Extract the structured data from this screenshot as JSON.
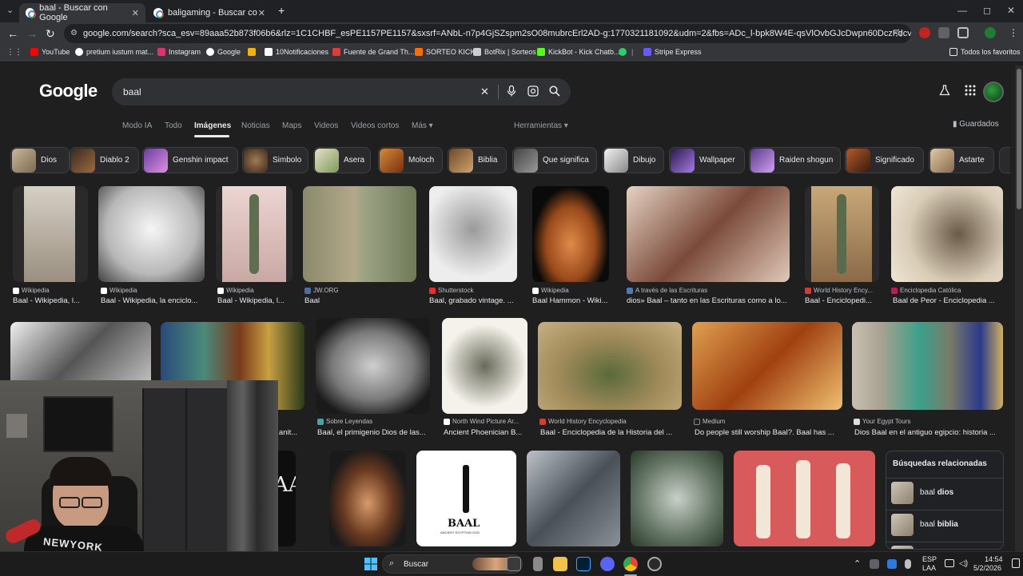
{
  "browser": {
    "tabs": [
      {
        "title": "baal - Buscar con Google",
        "close": "✕",
        "active": true
      },
      {
        "title": "baligaming - Buscar con Google",
        "close": "✕",
        "active": false
      }
    ],
    "new_tab": "+",
    "menu_chevron": "⌄",
    "window_controls": {
      "minimize": "—",
      "maximize": "◻",
      "close": "✕"
    },
    "nav": {
      "back": "←",
      "forward": "→",
      "reload": "↻"
    },
    "url": "google.com/search?sca_esv=89aaa52b873f06b6&rlz=1C1CHBF_esPE1157PE1157&sxsrf=ANbL-n7p4GjSZspm2sO08mubrcErl2AD-g:1770321181092&udm=2&fbs=ADc_l-bpk8W4E-qsVlOvbGJcDwpn60DczFdcvPnuv8WQohHLTbSVIdBrj9mdwFjf...",
    "star": "☆",
    "bookmarks": [
      {
        "label": "YouTube",
        "color": "#ff0000"
      },
      {
        "label": "pretium iustum mat...",
        "color": "#ffffff"
      },
      {
        "label": "Instagram",
        "color": "#e1306c"
      },
      {
        "label": "Google",
        "color": "#ffffff"
      },
      {
        "label": "",
        "color": "#f4b400"
      },
      {
        "label": "10Notificaciones",
        "color": "#ffffff"
      },
      {
        "label": "Fuente de Grand Th...",
        "color": "#e53935"
      },
      {
        "label": "SORTEO KICK",
        "color": "#ff6d00"
      },
      {
        "label": "BotRix | Sorteos",
        "color": "#cccccc"
      },
      {
        "label": "KickBot - Kick Chatb...",
        "color": "#53fc18"
      },
      {
        "label": "",
        "color": "#25d366"
      },
      {
        "label": "|",
        "color": "transparent"
      },
      {
        "label": "Stripe Express",
        "color": "#635bff"
      }
    ],
    "all_bookmarks": "Todos los favoritos"
  },
  "google": {
    "logo": "Google",
    "query": "baal",
    "icons": {
      "clear": "✕",
      "mic": "🎙",
      "lens": "◎",
      "search": "⌕",
      "labs": "⚗",
      "apps": "⋮⋮"
    },
    "tabs": [
      "Modo IA",
      "Todo",
      "Imágenes",
      "Noticias",
      "Maps",
      "Videos",
      "Videos cortos",
      "Más ▾"
    ],
    "tools": "Herramientas ▾",
    "saved": "Guardados",
    "chips": [
      "Dios",
      "Diablo 2",
      "Genshin impact",
      "Simbolo",
      "Asera",
      "Moloch",
      "Biblia",
      "Que significa",
      "Dibujo",
      "Wallpaper",
      "Raiden shogun",
      "Significado",
      "Astarte"
    ],
    "row1": [
      {
        "source": "Wikipedia",
        "title": "Baal - Wikipedia, l..."
      },
      {
        "source": "Wikipedia",
        "title": "Baal - Wikipedia, la enciclo..."
      },
      {
        "source": "Wikipedia",
        "title": "Baal - Wikipedia, l..."
      },
      {
        "source": "JW.ORG",
        "title": "Baal"
      },
      {
        "source": "Shutterstock",
        "title": "Baal, grabado vintage. ..."
      },
      {
        "source": "Wikipedia",
        "title": "Baal Hammon - Wiki..."
      },
      {
        "source": "A través de las Escrituras",
        "title": "dios» Baal – tanto en las Escrituras como a lo..."
      },
      {
        "source": "World History Ency...",
        "title": "Baal - Enciclopedi..."
      },
      {
        "source": "Enciclopedia Católica",
        "title": "Baal de Peor - Enciclopedia ..."
      }
    ],
    "row2": [
      {
        "source": "",
        "title": ""
      },
      {
        "source": "",
        "title": "...anit..."
      },
      {
        "source": "Sobre Leyendas",
        "title": "Baal, el primigenio Dios de las..."
      },
      {
        "source": "North Wind Picture Ar...",
        "title": "Ancient Phoenician B..."
      },
      {
        "source": "World History Encyclopedia",
        "title": "Baal - Enciclopedia de la Historia del ..."
      },
      {
        "source": "Medium",
        "title": "Do people still worship Baal?. Baal has ..."
      },
      {
        "source": "Your Egypt Tours",
        "title": "Dios Baal en el antiguo egipcio: historia ..."
      }
    ],
    "row3_text": {
      "baal_logo": "BAAL",
      "baal_logo_sub": "ANCIENT EGYPTIAN GOD",
      "partial_baal": "AAL"
    },
    "related": {
      "heading": "Búsquedas relacionadas",
      "items": [
        {
          "prefix": "baal ",
          "bold": "dios"
        },
        {
          "prefix": "baal ",
          "bold": "biblia"
        }
      ]
    }
  },
  "webcam": {
    "hoodie_text": "NEWYORK"
  },
  "taskbar": {
    "search_placeholder": "Buscar",
    "search_icon": "⌕",
    "lang_top": "ESP",
    "lang_bottom": "LAA",
    "time": "14:54",
    "date": "5/2/2026",
    "chevron": "⌃"
  }
}
